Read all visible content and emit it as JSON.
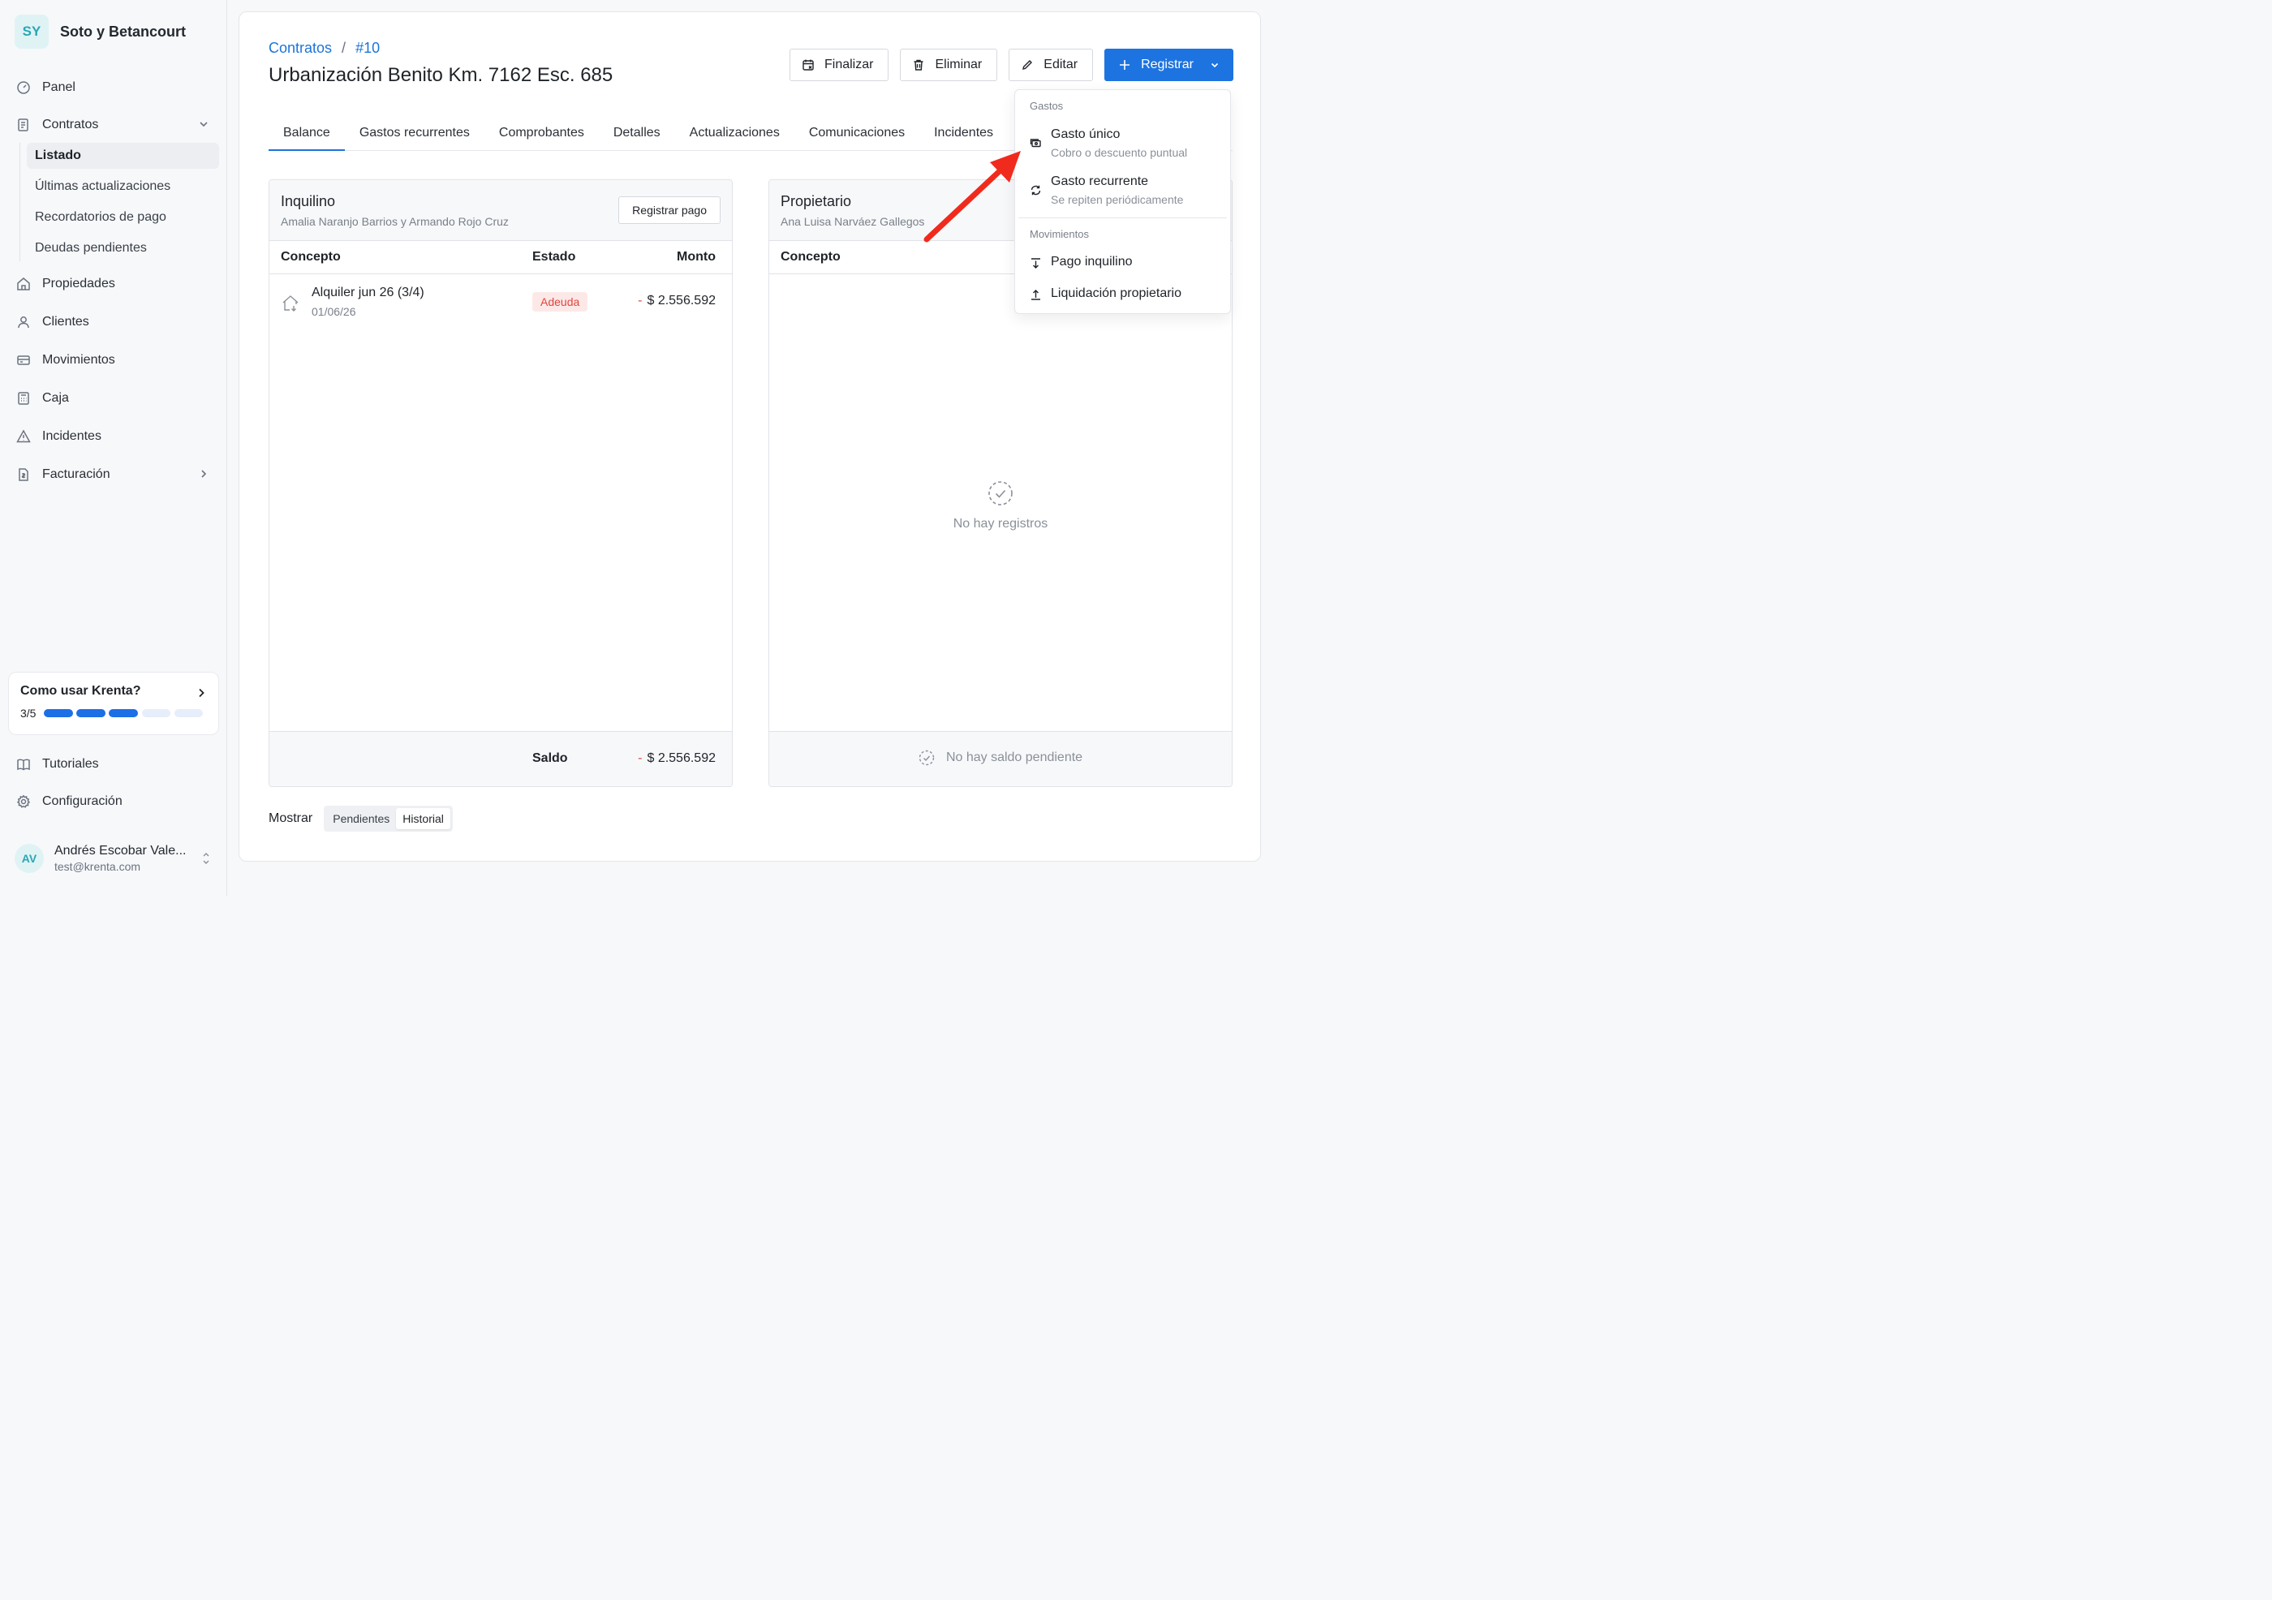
{
  "sidebar": {
    "brand_initials": "SY",
    "brand_name": "Soto y Betancourt",
    "items": [
      {
        "label": "Panel",
        "icon": "gauge-icon"
      },
      {
        "label": "Contratos",
        "icon": "contract-icon"
      },
      {
        "label": "Propiedades",
        "icon": "home-icon"
      },
      {
        "label": "Clientes",
        "icon": "user-icon"
      },
      {
        "label": "Movimientos",
        "icon": "card-icon"
      },
      {
        "label": "Caja",
        "icon": "calculator-icon"
      },
      {
        "label": "Incidentes",
        "icon": "warning-icon"
      },
      {
        "label": "Facturación",
        "icon": "invoice-icon"
      }
    ],
    "contratos_sub": [
      "Listado",
      "Últimas actualizaciones",
      "Recordatorios de pago",
      "Deudas pendientes"
    ],
    "guide": {
      "title": "Como usar Krenta?",
      "progress_text": "3/5",
      "completed": 3,
      "total": 5
    },
    "bottom": [
      {
        "label": "Tutoriales",
        "icon": "book-icon"
      },
      {
        "label": "Configuración",
        "icon": "gear-icon"
      }
    ],
    "user": {
      "initials": "AV",
      "name": "Andrés Escobar Vale...",
      "email": "test@krenta.com"
    }
  },
  "header": {
    "breadcrumb": [
      "Contratos",
      "#10"
    ],
    "breadcrumb_sep": "/",
    "title": "Urbanización Benito Km. 7162 Esc. 685",
    "actions": {
      "finalizar": "Finalizar",
      "eliminar": "Eliminar",
      "editar": "Editar",
      "registrar": "Registrar"
    }
  },
  "tabs": [
    "Balance",
    "Gastos recurrentes",
    "Comprobantes",
    "Detalles",
    "Actualizaciones",
    "Comunicaciones",
    "Incidentes"
  ],
  "inquilino": {
    "title": "Inquilino",
    "names": "Amalia Naranjo Barrios y Armando Rojo Cruz",
    "button": "Registrar pago",
    "columns": [
      "Concepto",
      "Estado",
      "Monto"
    ],
    "rows": [
      {
        "concept": "Alquiler jun 26 (3/4)",
        "date": "01/06/26",
        "status": "Adeuda",
        "sign": "-",
        "amount": "$ 2.556.592"
      }
    ],
    "saldo_label": "Saldo",
    "saldo_sign": "-",
    "saldo_amount": "$ 2.556.592"
  },
  "propietario": {
    "title": "Propietario",
    "names": "Ana Luisa Narváez Gallegos",
    "columns": [
      "Concepto"
    ],
    "empty_text": "No hay registros",
    "footer_text": "No hay saldo pendiente"
  },
  "mostrar": {
    "label": "Mostrar",
    "options": [
      "Pendientes",
      "Historial"
    ],
    "selected": "Historial"
  },
  "dropdown": {
    "group_gastos": "Gastos",
    "gasto_unico": {
      "title": "Gasto único",
      "sub": "Cobro o descuento puntual"
    },
    "gasto_recurrente": {
      "title": "Gasto recurrente",
      "sub": "Se repiten periódicamente"
    },
    "group_movimientos": "Movimientos",
    "pago_inquilino": "Pago inquilino",
    "liquidacion": "Liquidación propietario"
  },
  "colors": {
    "accent": "#1d74e0",
    "danger": "#e0463c",
    "annotation_arrow": "#f02b1d"
  }
}
